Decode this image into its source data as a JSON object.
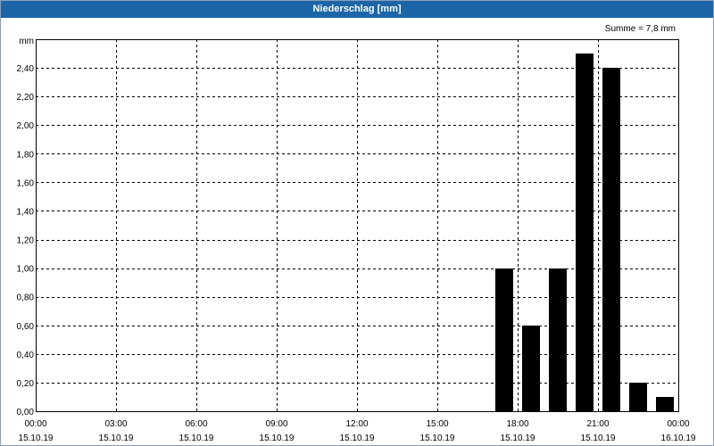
{
  "title": "Niederschlag [mm]",
  "summary": "Summe = 7,8 mm",
  "colors": {
    "titlebar": "#1c66a8",
    "bar": "#000000",
    "grid": "#000000"
  },
  "chart_data": {
    "type": "bar",
    "title": "Niederschlag [mm]",
    "ylabel": "mm",
    "xlabel": "",
    "ylim": [
      0,
      2.6
    ],
    "yticks": [
      0,
      0.2,
      0.4,
      0.6,
      0.8,
      1.0,
      1.2,
      1.4,
      1.6,
      1.8,
      2.0,
      2.2,
      2.4
    ],
    "ytick_labels": [
      "0,00",
      "0,20",
      "0,40",
      "0,60",
      "0,80",
      "1,00",
      "1,20",
      "1,40",
      "1,60",
      "1,80",
      "2,00",
      "2,20",
      "2,40"
    ],
    "xlim_hours": [
      0,
      24
    ],
    "xticks_hours": [
      0,
      3,
      6,
      9,
      12,
      15,
      18,
      21,
      24
    ],
    "xtick_labels": [
      [
        "00:00",
        "15.10.19"
      ],
      [
        "03:00",
        "15.10.19"
      ],
      [
        "06:00",
        "15.10.19"
      ],
      [
        "09:00",
        "15.10.19"
      ],
      [
        "12:00",
        "15.10.19"
      ],
      [
        "15:00",
        "15.10.19"
      ],
      [
        "18:00",
        "15.10.19"
      ],
      [
        "21:00",
        "15.10.19"
      ],
      [
        "00:00",
        "16.10.19"
      ]
    ],
    "grid": true,
    "summary": "Summe = 7,8 mm",
    "bars": [
      {
        "hour": 17.5,
        "value": 1.0
      },
      {
        "hour": 18.5,
        "value": 0.6
      },
      {
        "hour": 19.5,
        "value": 1.0
      },
      {
        "hour": 20.5,
        "value": 2.5
      },
      {
        "hour": 21.5,
        "value": 2.4
      },
      {
        "hour": 22.5,
        "value": 0.2
      },
      {
        "hour": 23.5,
        "value": 0.1
      }
    ]
  }
}
